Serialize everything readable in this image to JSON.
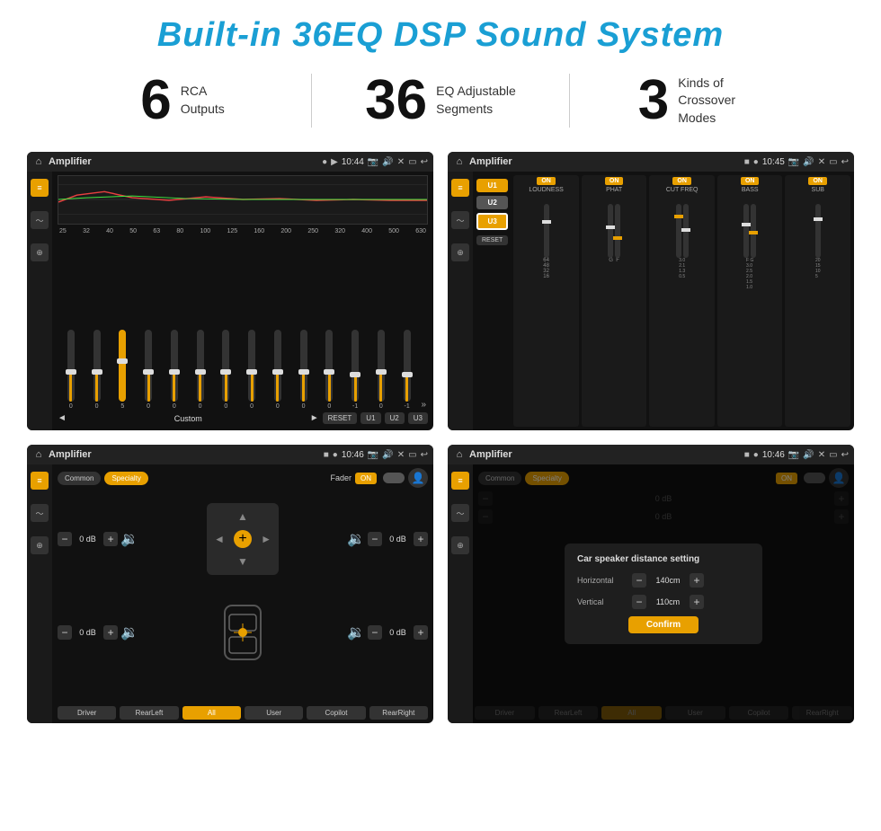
{
  "header": {
    "title": "Built-in 36EQ DSP Sound System"
  },
  "stats": [
    {
      "number": "6",
      "text": "RCA\nOutputs"
    },
    {
      "number": "36",
      "text": "EQ Adjustable\nSegments"
    },
    {
      "number": "3",
      "text": "Kinds of\nCrossover Modes"
    }
  ],
  "screens": [
    {
      "id": "eq-screen",
      "title": "Amplifier",
      "time": "10:44",
      "type": "equalizer",
      "freq_labels": [
        "25",
        "32",
        "40",
        "50",
        "63",
        "80",
        "100",
        "125",
        "160",
        "200",
        "250",
        "320",
        "400",
        "500",
        "630"
      ],
      "sliders": [
        0,
        0,
        5,
        0,
        0,
        0,
        0,
        0,
        0,
        0,
        0,
        -1,
        0,
        -1
      ],
      "bottom": [
        "◄",
        "Custom",
        "►",
        "RESET",
        "U1",
        "U2",
        "U3"
      ]
    },
    {
      "id": "crossover-screen",
      "title": "Amplifier",
      "time": "10:45",
      "type": "crossover",
      "u_buttons": [
        "U1",
        "U2",
        "U3"
      ],
      "channels": [
        "LOUDNESS",
        "PHAT",
        "CUT FREQ",
        "BASS",
        "SUB"
      ],
      "reset_label": "RESET"
    },
    {
      "id": "fader-screen",
      "title": "Amplifier",
      "time": "10:46",
      "type": "fader",
      "tabs": [
        "Common",
        "Specialty"
      ],
      "fader_label": "Fader",
      "on_label": "ON",
      "speakers": {
        "front_left_db": "0 dB",
        "front_right_db": "0 dB",
        "rear_left_db": "0 dB",
        "rear_right_db": "0 dB"
      },
      "bottom_btns": [
        "Driver",
        "RearLeft",
        "All",
        "User",
        "Copilot",
        "RearRight"
      ]
    },
    {
      "id": "distance-screen",
      "title": "Amplifier",
      "time": "10:46",
      "type": "distance",
      "tabs": [
        "Common",
        "Specialty"
      ],
      "on_label": "ON",
      "dialog": {
        "title": "Car speaker distance setting",
        "horizontal_label": "Horizontal",
        "horizontal_value": "140cm",
        "vertical_label": "Vertical",
        "vertical_value": "110cm",
        "confirm_label": "Confirm"
      },
      "bottom_btns": [
        "Driver",
        "RearLeft",
        "All",
        "User",
        "Copilot",
        "RearRight"
      ]
    }
  ]
}
